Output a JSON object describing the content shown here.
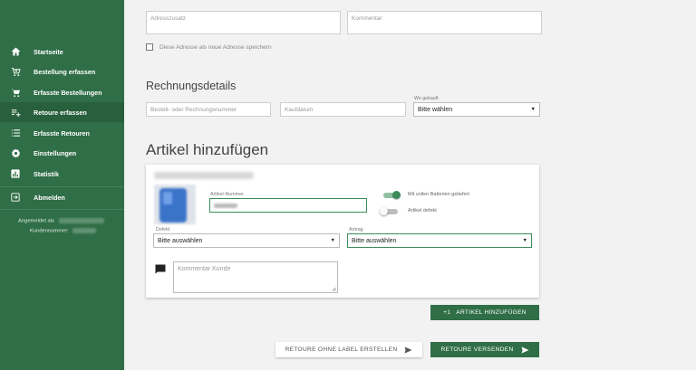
{
  "sidebar": {
    "items": [
      {
        "label": "Startseite",
        "icon": "home-icon"
      },
      {
        "label": "Bestellung erfassen",
        "icon": "cart-add-icon"
      },
      {
        "label": "Erfasste Bestellungen",
        "icon": "cart-icon"
      },
      {
        "label": "Retoure erfassen",
        "icon": "playlist-add-icon"
      },
      {
        "label": "Erfasste Retouren",
        "icon": "list-icon"
      },
      {
        "label": "Einstellungen",
        "icon": "gear-icon"
      },
      {
        "label": "Statistik",
        "icon": "bar-chart-icon"
      }
    ],
    "logout": {
      "label": "Abmelden",
      "icon": "logout-icon"
    },
    "user": {
      "logged_in_label": "Angemeldet als",
      "customer_label": "Kundennummer:"
    }
  },
  "address": {
    "zusatz_placeholder": "Adresszusatz",
    "kommentar_placeholder": "Kommentar",
    "save_checkbox_label": "Diese Adresse als neue Adresse speichern"
  },
  "invoice": {
    "title": "Rechnungsdetails",
    "order_number_placeholder": "Bestell- oder Rechnungsnummer",
    "date_placeholder": "Kaufdatum",
    "where_label": "Wo gekauft",
    "where_value": "Bitte wählen"
  },
  "article": {
    "title": "Artikel hinzufügen",
    "number_label": "Artikel-Nummer",
    "toggle_batteries_label": "Mit vollen Batterien geliefert",
    "toggle_batteries_on": true,
    "toggle_defect_label": "Artikel defekt",
    "toggle_defect_on": false,
    "defect_label": "Defekt",
    "defect_value": "Bitte auswählen",
    "request_label": "Antrag",
    "request_value": "Bitte auswählen",
    "comment_placeholder": "Kommentar Kunde"
  },
  "buttons": {
    "add_article": "+1   ARTIKEL HINZUFÜGEN",
    "return_no_label": "RETOURE OHNE LABEL ERSTELLEN",
    "send_return": "RETOURE VERSENDEN"
  },
  "colors": {
    "brand_green": "#2f6e46",
    "toggle_green": "#3d8c5a"
  }
}
